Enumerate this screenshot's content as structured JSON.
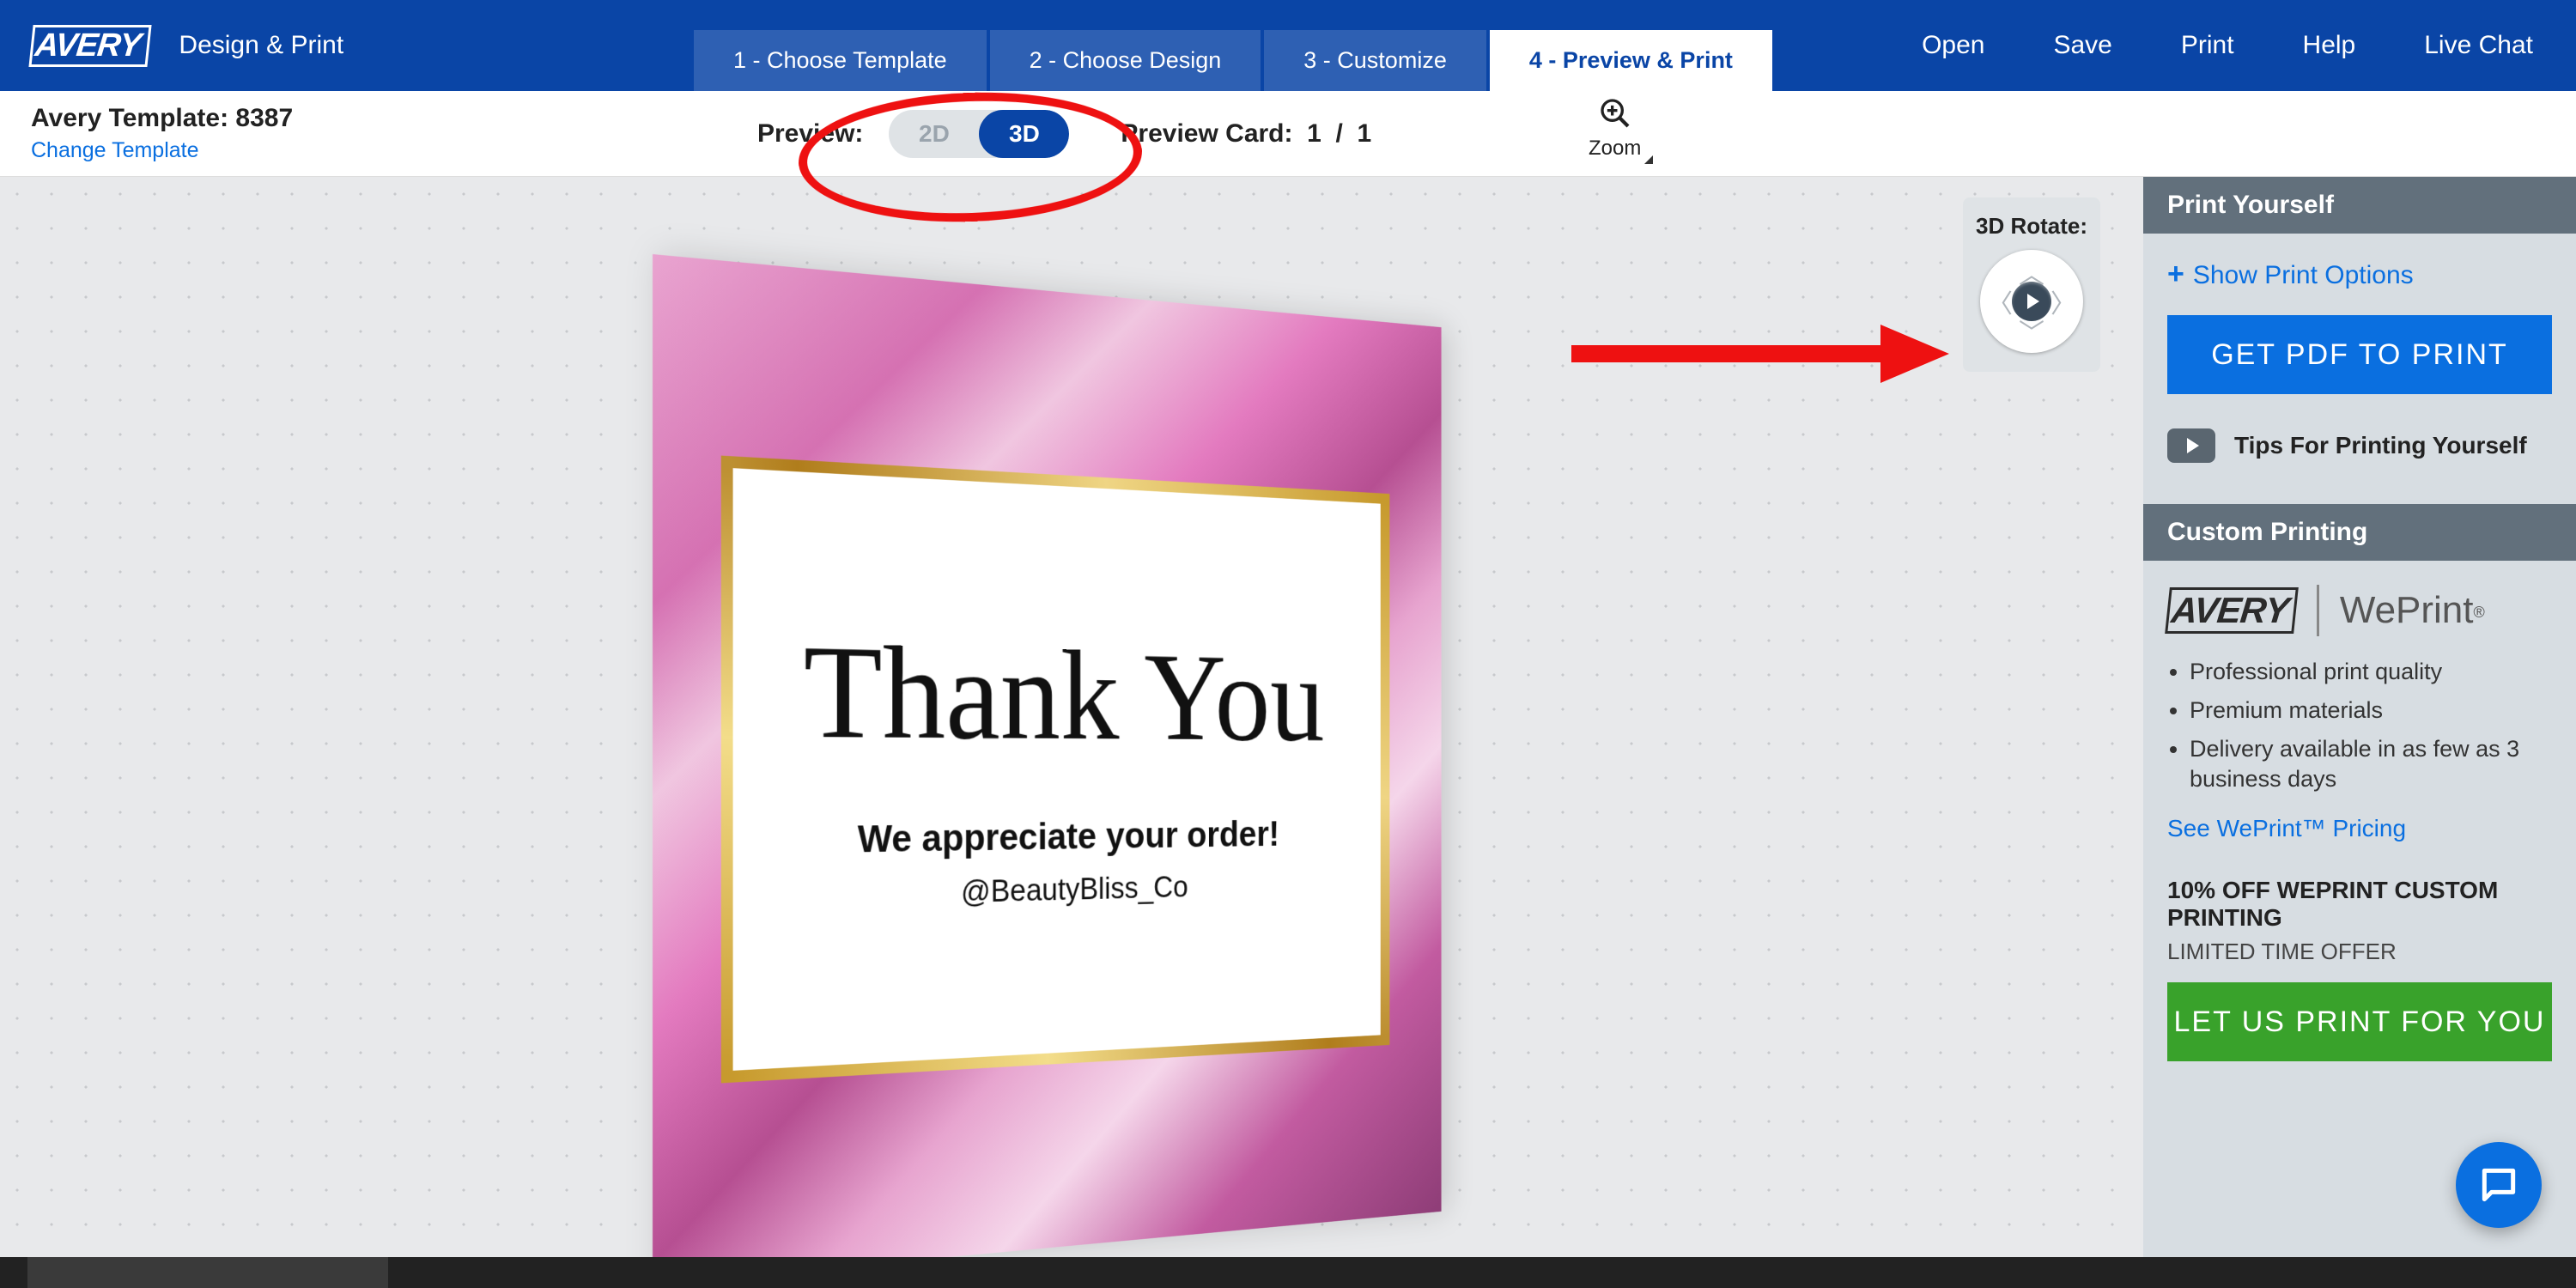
{
  "header": {
    "brand": "AVERY",
    "product": "Design & Print",
    "tabs": [
      {
        "label": "1 - Choose Template",
        "active": false
      },
      {
        "label": "2 - Choose Design",
        "active": false
      },
      {
        "label": "3 - Customize",
        "active": false
      },
      {
        "label": "4 - Preview & Print",
        "active": true
      }
    ],
    "menu": [
      "Open",
      "Save",
      "Print",
      "Help",
      "Live Chat"
    ]
  },
  "subheader": {
    "template_title": "Avery Template: 8387",
    "change_template": "Change Template",
    "preview_label": "Preview:",
    "toggle_2d": "2D",
    "toggle_3d": "3D",
    "card_label": "Preview Card:",
    "current": "1",
    "sep": "/",
    "total": "1",
    "zoom": "Zoom"
  },
  "rotate_widget": {
    "title": "3D Rotate:"
  },
  "card": {
    "headline": "Thank You",
    "sub": "We appreciate your order!",
    "handle": "@BeautyBliss_Co"
  },
  "sidebar": {
    "print_yourself": {
      "title": "Print Yourself",
      "show_options": "Show Print Options",
      "get_pdf": "GET PDF TO PRINT",
      "tips": "Tips For Printing Yourself"
    },
    "custom_printing": {
      "title": "Custom Printing",
      "logo_brand": "AVERY",
      "logo_service": "WePrint",
      "bullets": [
        "Professional print quality",
        "Premium materials",
        "Delivery available in as few as 3 business days"
      ],
      "pricing_link": "See WePrint™ Pricing",
      "promo_title": "10% OFF WEPRINT CUSTOM PRINTING",
      "promo_sub": "LIMITED TIME OFFER",
      "cta": "LET US PRINT FOR YOU"
    }
  }
}
